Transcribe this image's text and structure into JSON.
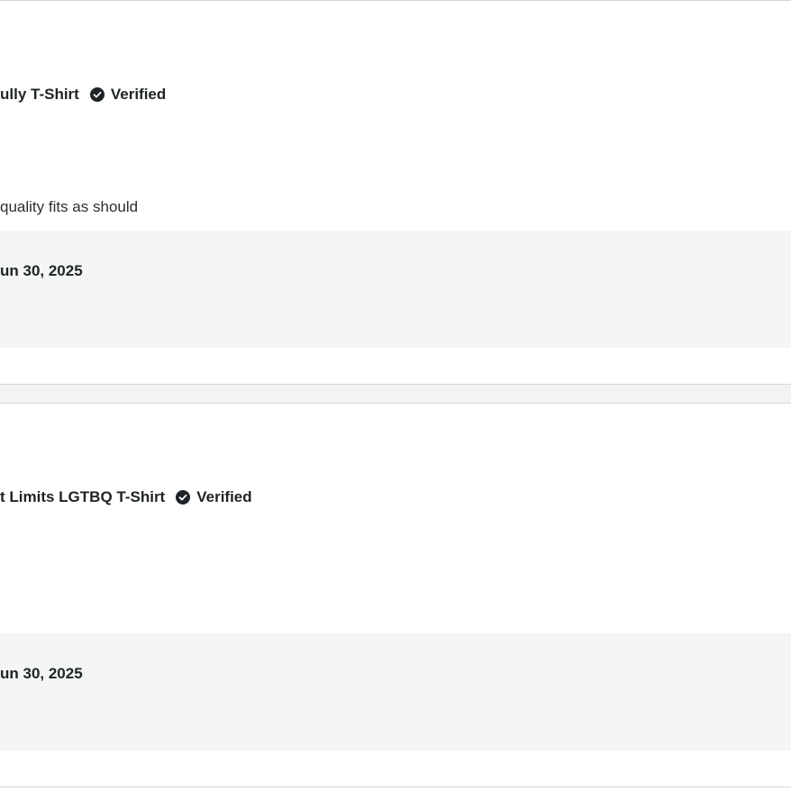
{
  "reviews": [
    {
      "product_name": "ully T-Shirt",
      "verified_label": "Verified",
      "verified_icon": "check-circle-icon",
      "review_text": "quality fits as should",
      "date": "un 30, 2025"
    },
    {
      "product_name": "t Limits LGTBQ T-Shirt",
      "verified_label": "Verified",
      "verified_icon": "check-circle-icon",
      "review_text": "",
      "date": "un 30, 2025"
    }
  ]
}
